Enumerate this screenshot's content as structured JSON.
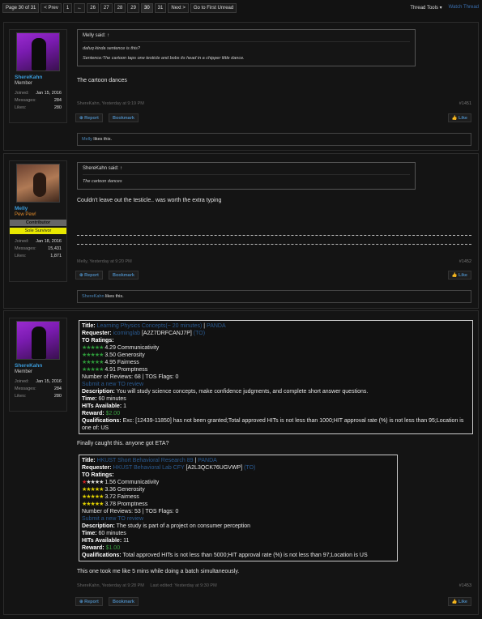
{
  "pagenav": {
    "label": "Page 30 of 31",
    "prev": "< Prev",
    "first": "1",
    "arrow": "←",
    "pages": [
      "26",
      "27",
      "28",
      "29",
      "30",
      "31"
    ],
    "next": "Next >",
    "unread": "Go to First Unread"
  },
  "tools": {
    "thread_tools": "Thread Tools ▾",
    "watch": "Watch Thread"
  },
  "posts": [
    {
      "user": {
        "name": "ShereKahn",
        "title": "Member",
        "joined_k": "Joined:",
        "joined": "Jan 15, 2016",
        "messages_k": "Messages:",
        "messages": "284",
        "likes_k": "Likes:",
        "likes": "280"
      },
      "quote": {
        "said": "Melly said: ↑",
        "line1": "dafuq kinda sentence is this?",
        "line2": "Sentence:The cartoon taps one testicle and bobs its head in a chipper little dance."
      },
      "message": "The cartoon dances",
      "meta": "ShereKahn, Yesterday at 9:19 PM",
      "num": "#1451",
      "report": "⊕ Report",
      "bookmark": "Bookmark",
      "like": "👍 Like",
      "likes_user": "Melly",
      "likes_text": " likes this."
    },
    {
      "user": {
        "name": "Melly",
        "title": "Pew Pew!",
        "contributor": "Contributor",
        "sole": "Sole Survivor",
        "joined_k": "Joined:",
        "joined": "Jan 18, 2016",
        "messages_k": "Messages:",
        "messages": "15,431",
        "likes_k": "Likes:",
        "likes": "1,871"
      },
      "quote": {
        "said": "ShereKahn said: ↑",
        "line1": "The cartoon dances"
      },
      "message": "Couldn't leave out the testicle.. was worth the extra typing",
      "meta": "Melly, Yesterday at 9:20 PM",
      "num": "#1452",
      "report": "⊕ Report",
      "bookmark": "Bookmark",
      "like": "👍 Like",
      "likes_user": "ShereKahn",
      "likes_text": " likes this."
    },
    {
      "user": {
        "name": "ShereKahn",
        "title": "Member",
        "joined_k": "Joined:",
        "joined": "Jan 15, 2016",
        "messages_k": "Messages:",
        "messages": "284",
        "likes_k": "Likes:",
        "likes": "280"
      },
      "hit1": {
        "title_k": "Title:",
        "title": "Learning Physics Concepts(~ 20 minutes)",
        "sep": " | ",
        "panda": "PANDA",
        "req_k": "Requester:",
        "req": "icominglab",
        "req_id": "[A2Z7DRFCANJ7P]",
        "req_to": "(TO)",
        "ratings_k": "TO Ratings:",
        "r1_stars": "★★★★★",
        "r1": " 4.29 Communicativity",
        "r2_stars": "★★★★★",
        "r2": " 3.50 Generosity",
        "r3_stars": "★★★★★",
        "r3": " 4.95 Fairness",
        "r4_stars": "★★★★★",
        "r4": " 4.91 Promptness",
        "reviews": "Number of Reviews: 68 | TOS Flags: 0",
        "submit": "Submit a new TO review",
        "desc_k": "Description:",
        "desc": " You will study science concepts, make confidence judgments, and complete short answer questions.",
        "time_k": "Time:",
        "time": " 60 minutes",
        "avail_k": "HITs Available:",
        "avail": " 1",
        "reward_k": "Reward:",
        "reward": "$2.00",
        "qual_k": "Qualifications:",
        "qual": " Exc: [12439-11850] has not been granted;Total approved HITs is not less than 1000;HIT approval rate (%) is not less than 95;Location is one of: US"
      },
      "message1": "Finally caught this. anyone got ETA?",
      "hit2": {
        "title_k": "Title:",
        "title": "HKUST Short Behavioral Research 89",
        "sep": " | ",
        "panda": "PANDA",
        "req_k": "Requester:",
        "req": "HKUST Behavioral Lab CFY",
        "req_id": "[A2L3QCK76UGVWP]",
        "req_to": "(TO)",
        "ratings_k": "TO Ratings:",
        "r1_stars": "★★★★★",
        "r1": " 1.56 Communicativity",
        "r2_stars": "★★★★★",
        "r2": " 3.36 Generosity",
        "r3_stars": "★★★★★",
        "r3": " 3.72 Fairness",
        "r4_stars": "★★★★★",
        "r4": " 3.78 Promptness",
        "reviews": "Number of Reviews: 53 | TOS Flags: 0",
        "submit": "Submit a new TO review",
        "desc_k": "Description:",
        "desc": " The study is part of a project on consumer perception",
        "time_k": "Time:",
        "time": " 60 minutes",
        "avail_k": "HITs Available:",
        "avail": " 11",
        "reward_k": "Reward:",
        "reward": "$1.00",
        "qual_k": "Qualifications:",
        "qual": " Total approved HITs is not less than 5000;HIT approval rate (%) is not less than 97;Location is US"
      },
      "message2": "This one took me like 5 mins while doing a batch simultaneously.",
      "meta": "ShereKahn, Yesterday at 9:28 PM",
      "edited": "Last edited: Yesterday at 9:30 PM",
      "num": "#1453",
      "report": "⊕ Report",
      "bookmark": "Bookmark",
      "like": "👍 Like"
    }
  ]
}
